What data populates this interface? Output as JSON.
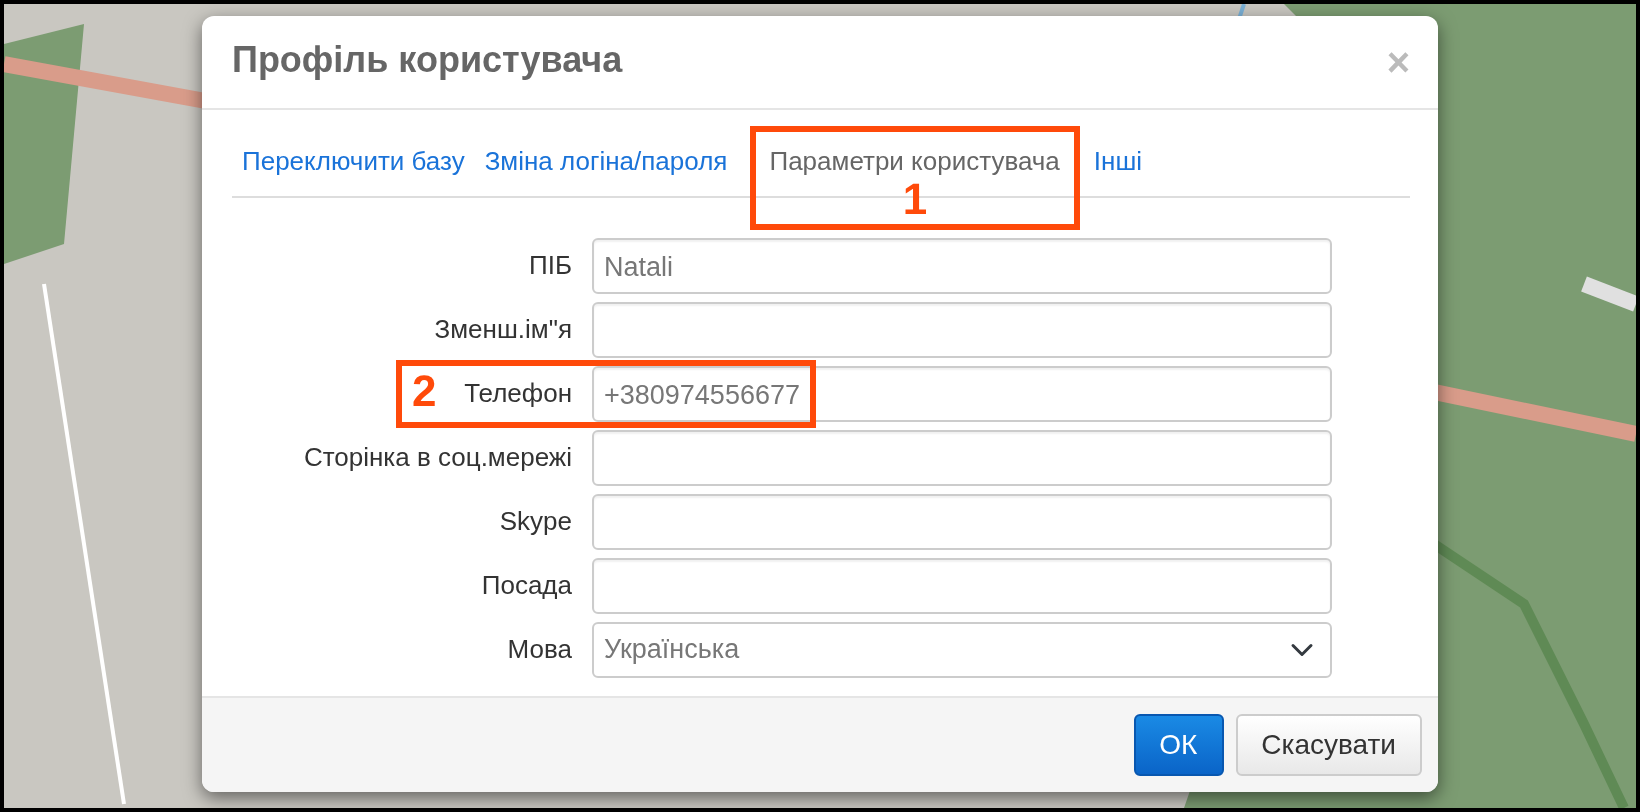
{
  "dialog": {
    "title": "Профіль користувача",
    "close": "×"
  },
  "tabs": [
    {
      "label": "Переключити базу",
      "selected": false
    },
    {
      "label": "Зміна логіна/пароля",
      "selected": false
    },
    {
      "label": "Параметри користувача",
      "selected": true,
      "annotation": "1"
    },
    {
      "label": "Інші",
      "selected": false
    }
  ],
  "fields": [
    {
      "label": "ПІБ",
      "kind": "input",
      "value": "Natali"
    },
    {
      "label": "Зменш.ім\"я",
      "kind": "input"
    },
    {
      "label": "Телефон",
      "kind": "input",
      "value": "+380974556677",
      "annotation": "2"
    },
    {
      "label": "Сторінка в соц.мережі",
      "kind": "input"
    },
    {
      "label": "Skype",
      "kind": "input"
    },
    {
      "label": "Посада",
      "kind": "input"
    },
    {
      "label": "Мова",
      "kind": "select",
      "value": "Українська"
    }
  ],
  "buttons": [
    {
      "label": "ОК",
      "kind": "primary"
    },
    {
      "label": "Скасувати",
      "kind": "secondary"
    }
  ]
}
